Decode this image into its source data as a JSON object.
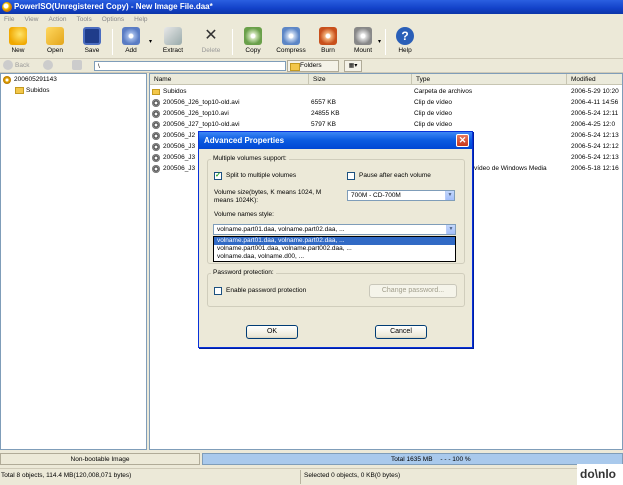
{
  "window": {
    "title": "PowerISO(Unregistered Copy) - New Image File.daa*"
  },
  "menu": [
    "File",
    "View",
    "Action",
    "Tools",
    "Options",
    "Help"
  ],
  "toolbar": {
    "new": "New",
    "open": "Open",
    "save": "Save",
    "add": "Add",
    "extract": "Extract",
    "delete": "Delete",
    "copy": "Copy",
    "compress": "Compress",
    "burn": "Burn",
    "mount": "Mount",
    "help": "Help"
  },
  "nav": {
    "back": "Back",
    "path": "\\",
    "folders": "Folders"
  },
  "tree": {
    "root": "200605291143",
    "child": "Subidos"
  },
  "filelist": {
    "columns": [
      "Name",
      "Size",
      "Type",
      "Modified"
    ],
    "rows": [
      {
        "name": "Subidos",
        "size": "",
        "type": "Carpeta de archivos",
        "modified": "2006-5-29 10:20",
        "kind": "folder"
      },
      {
        "name": "200506_J26_top10-old.avi",
        "size": "6557 KB",
        "type": "Clip de vídeo",
        "modified": "2006-4-11 14:56",
        "kind": "video"
      },
      {
        "name": "200506_J26_top10.avi",
        "size": "24855 KB",
        "type": "Clip de vídeo",
        "modified": "2006-5-24 12:11",
        "kind": "video"
      },
      {
        "name": "200506_J27_top10-old.avi",
        "size": "5797 KB",
        "type": "Clip de vídeo",
        "modified": "2006-4-25 12:0",
        "kind": "video"
      },
      {
        "name": "200506_J2",
        "size": "",
        "type": "",
        "modified": "2006-5-24 12:13",
        "kind": "video"
      },
      {
        "name": "200506_J3",
        "size": "",
        "type": "",
        "modified": "2006-5-24 12:12",
        "kind": "video"
      },
      {
        "name": "200506_J3",
        "size": "",
        "type": "",
        "modified": "2006-5-24 12:13",
        "kind": "video"
      },
      {
        "name": "200506_J3",
        "size": "",
        "type": "vídeo de Windows Media",
        "modified": "2006-5-18 12:16",
        "kind": "video"
      }
    ]
  },
  "dialog": {
    "title": "Advanced Properties",
    "multi_group": "Multiple volumes support:",
    "split_label": "Split to multiple volumes",
    "split_checked": true,
    "pause_label": "Pause after each volume",
    "pause_checked": false,
    "size_label_1": "Volume size(bytes, K means 1024, M",
    "size_label_2": "means 1024K):",
    "size_value": "700M - CD-700M",
    "style_label": "Volume names style:",
    "style_value": "volname.part01.daa, volname.part02.daa, ...",
    "style_options": [
      "volname.part01.daa, volname.part02.daa, ...",
      "volname.part001.daa, volname.part002.daa, ...",
      "volname.daa, volname.d00, ..."
    ],
    "pwd_group": "Password protection:",
    "pwd_label": "Enable password protection",
    "pwd_checked": false,
    "change_pwd": "Change password...",
    "ok": "OK",
    "cancel": "Cancel"
  },
  "status": {
    "image_type": "Non-bootable Image",
    "total": "Total  1635 MB",
    "percent": "- - -  100 %",
    "objects": "Total 8 objects, 114.4 MB(120,008,071 bytes)",
    "selected": "Selected 0 objects, 0 KB(0 bytes)"
  },
  "watermark": "do\\nlo",
  "colors": {
    "titlebar": "#1241c8",
    "selection": "#316ac5",
    "progress": "#a9c9ec"
  }
}
